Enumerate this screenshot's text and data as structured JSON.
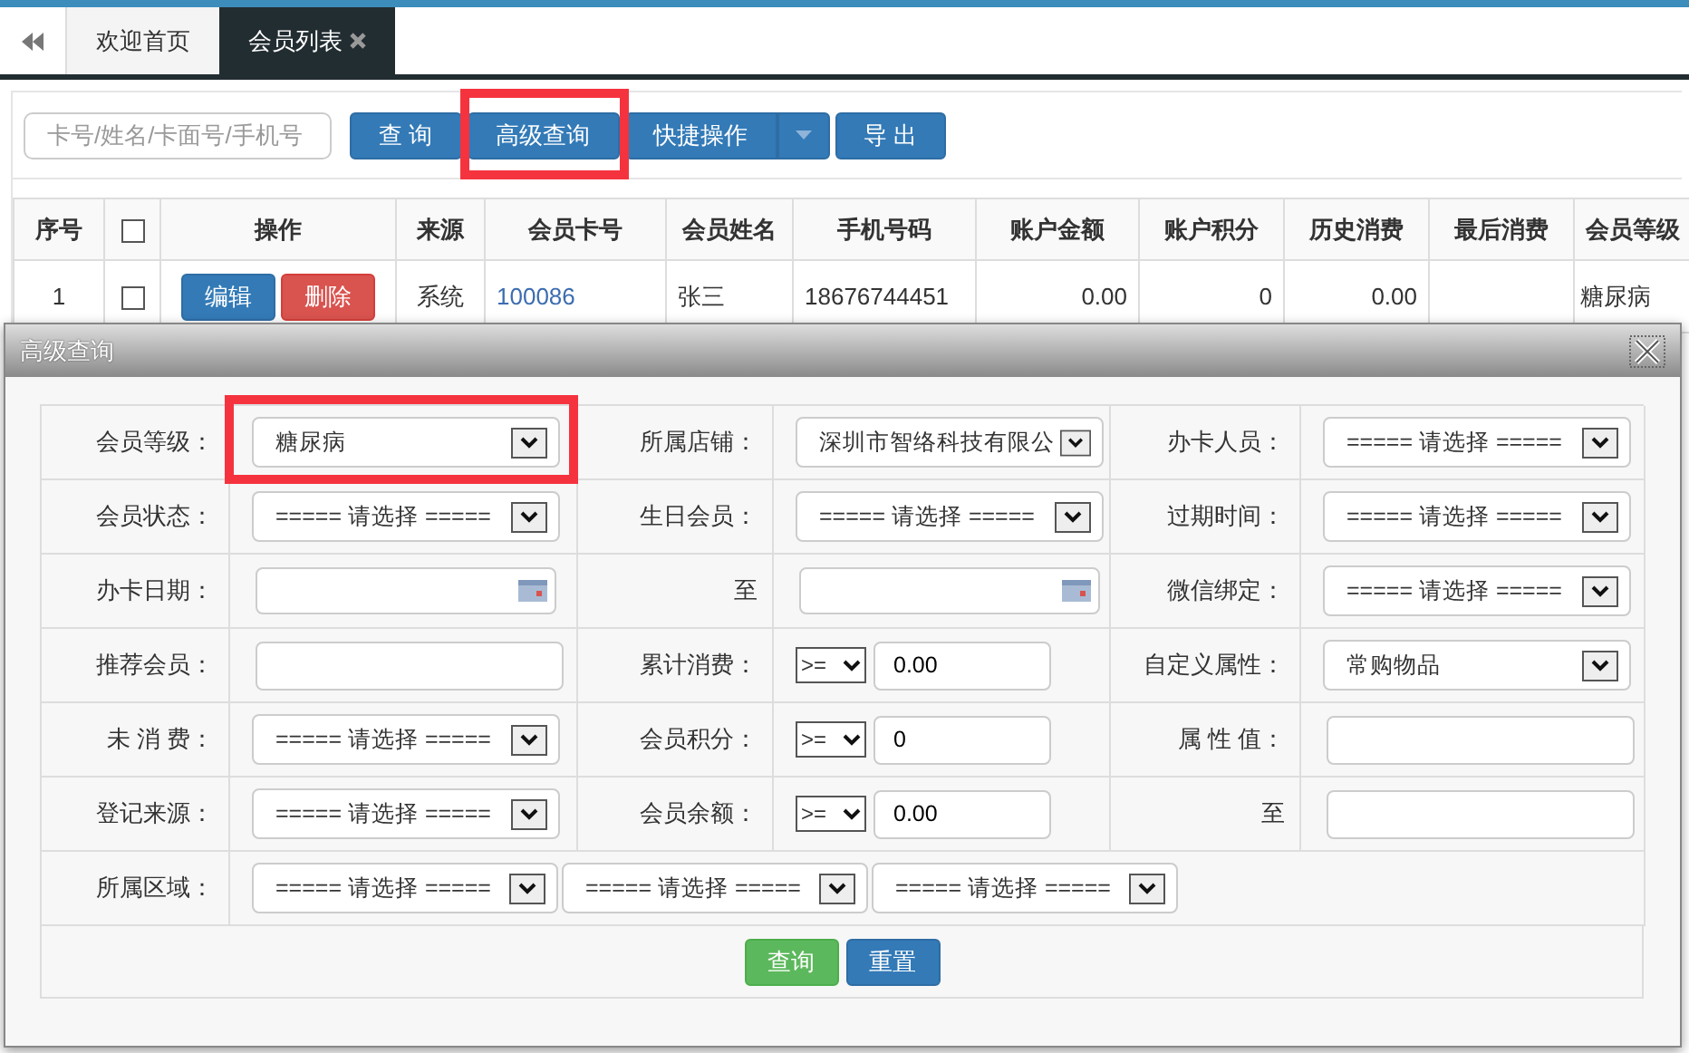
{
  "tabs": [
    {
      "label": "欢迎首页",
      "selected": false,
      "closable": false
    },
    {
      "label": "会员列表",
      "selected": true,
      "closable": true
    }
  ],
  "toolbar": {
    "search": {
      "placeholder": "卡号/姓名/卡面号/手机号"
    },
    "buttons": [
      {
        "label": "查 询",
        "kind": "button"
      },
      {
        "label": "高级查询",
        "kind": "button",
        "highlighted": true
      },
      {
        "label": "快捷操作",
        "kind": "split"
      },
      {
        "label": "导 出",
        "kind": "button"
      }
    ]
  },
  "table": {
    "columns": [
      "序号",
      "",
      "操作",
      "来源",
      "会员卡号",
      "会员姓名",
      "手机号码",
      "账户金额",
      "账户积分",
      "历史消费",
      "最后消费",
      "会员等级"
    ],
    "select_all_checked": false,
    "rows": [
      {
        "index": "1",
        "checked": false,
        "actions": [
          "编辑",
          "删除"
        ],
        "source": "系统",
        "card_no": "100086",
        "name": "张三",
        "phone": "18676744451",
        "balance": "0.00",
        "points": "0",
        "history": "0.00",
        "last": "",
        "level": "糖尿病"
      }
    ]
  },
  "modal": {
    "title": "高级查询",
    "rows": [
      [
        {
          "label": "会员等级：",
          "fields": [
            {
              "kind": "select",
              "value": "糖尿病",
              "highlighted": true
            }
          ]
        },
        {
          "label": "所属店铺：",
          "fields": [
            {
              "kind": "select",
              "value": "深圳市智络科技有限公",
              "highlighted": false
            }
          ]
        },
        {
          "label": "办卡人员：",
          "fields": [
            {
              "kind": "select",
              "value": "===== 请选择 =====",
              "highlighted": false
            }
          ]
        }
      ],
      [
        {
          "label": "会员状态：",
          "fields": [
            {
              "kind": "select",
              "value": "===== 请选择 =====",
              "highlighted": false
            }
          ]
        },
        {
          "label": "生日会员：",
          "fields": [
            {
              "kind": "select",
              "value": "===== 请选择 =====",
              "highlighted": false
            }
          ]
        },
        {
          "label": "过期时间：",
          "fields": [
            {
              "kind": "select",
              "value": "===== 请选择 =====",
              "highlighted": false
            }
          ]
        }
      ],
      [
        {
          "label": "办卡日期：",
          "fields": [
            {
              "kind": "date"
            }
          ]
        },
        {
          "label": "至",
          "fields": [
            {
              "kind": "date"
            }
          ]
        },
        {
          "label": "微信绑定：",
          "fields": [
            {
              "kind": "select",
              "value": "===== 请选择 =====",
              "highlighted": false
            }
          ]
        }
      ],
      [
        {
          "label": "推荐会员：",
          "fields": [
            {
              "kind": "text"
            }
          ]
        },
        {
          "label": "累计消费：",
          "fields": [
            {
              "kind": "compare",
              "operator": ">=",
              "value": "0.00"
            }
          ]
        },
        {
          "label": "自定义属性：",
          "fields": [
            {
              "kind": "select",
              "value": "常购物品",
              "highlighted": false
            }
          ]
        }
      ],
      [
        {
          "label": "未 消 费：",
          "fields": [
            {
              "kind": "select",
              "value": "===== 请选择 =====",
              "highlighted": false
            }
          ]
        },
        {
          "label": "会员积分：",
          "fields": [
            {
              "kind": "compare",
              "operator": ">=",
              "value": "0"
            }
          ]
        },
        {
          "label": "属 性 值：",
          "fields": [
            {
              "kind": "text"
            }
          ]
        }
      ],
      [
        {
          "label": "登记来源：",
          "fields": [
            {
              "kind": "select",
              "value": "===== 请选择 =====",
              "highlighted": false
            }
          ]
        },
        {
          "label": "会员余额：",
          "fields": [
            {
              "kind": "compare",
              "operator": ">=",
              "value": "0.00"
            }
          ]
        },
        {
          "label": "至",
          "fields": [
            {
              "kind": "text"
            }
          ]
        }
      ],
      [
        {
          "label": "所属区域：",
          "fields": [
            {
              "kind": "select",
              "value": "===== 请选择 =====",
              "highlighted": false
            },
            {
              "kind": "select",
              "value": "===== 请选择 =====",
              "highlighted": false
            },
            {
              "kind": "select",
              "value": "===== 请选择 =====",
              "highlighted": false
            }
          ]
        }
      ]
    ],
    "buttons": [
      {
        "label": "查询",
        "kind": "success"
      },
      {
        "label": "重置",
        "kind": "primary"
      }
    ]
  }
}
